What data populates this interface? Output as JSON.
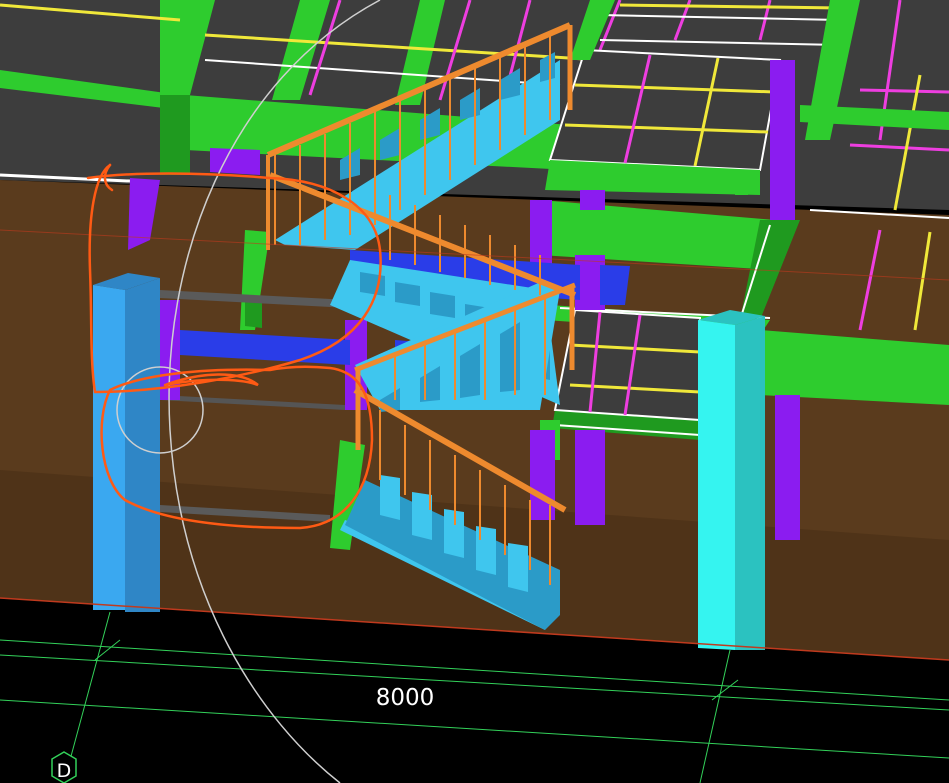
{
  "viewport": {
    "background": "#000000"
  },
  "dimension": {
    "value_label": "8000"
  },
  "grid_axis": {
    "label": "D"
  },
  "palette": {
    "slab": "#3d3d3d",
    "slab_edge": "#ffffff",
    "beam_green": "#2ecc2e",
    "beam_green_dark": "#1f9a1f",
    "wall_brown": "#5a3b1d",
    "column_blue": "#3aa8f0",
    "column_cyan": "#35f4f0",
    "column_purple": "#8b1cf0",
    "stair_cyan": "#3fc6ee",
    "stair_blue": "#2a3de8",
    "railing_orange": "#ee8a2e",
    "grid_yellow": "#f0e83a",
    "grid_magenta": "#ee3ee0",
    "markup_orange": "#ff5a14",
    "snap_circle": "#cfcfcf",
    "dim_green": "#33d15a",
    "ref_red": "#c03a1e"
  },
  "icons": {
    "grid_bubble": "hexagon-axis-bubble-icon",
    "snap": "snap-circle-icon"
  }
}
